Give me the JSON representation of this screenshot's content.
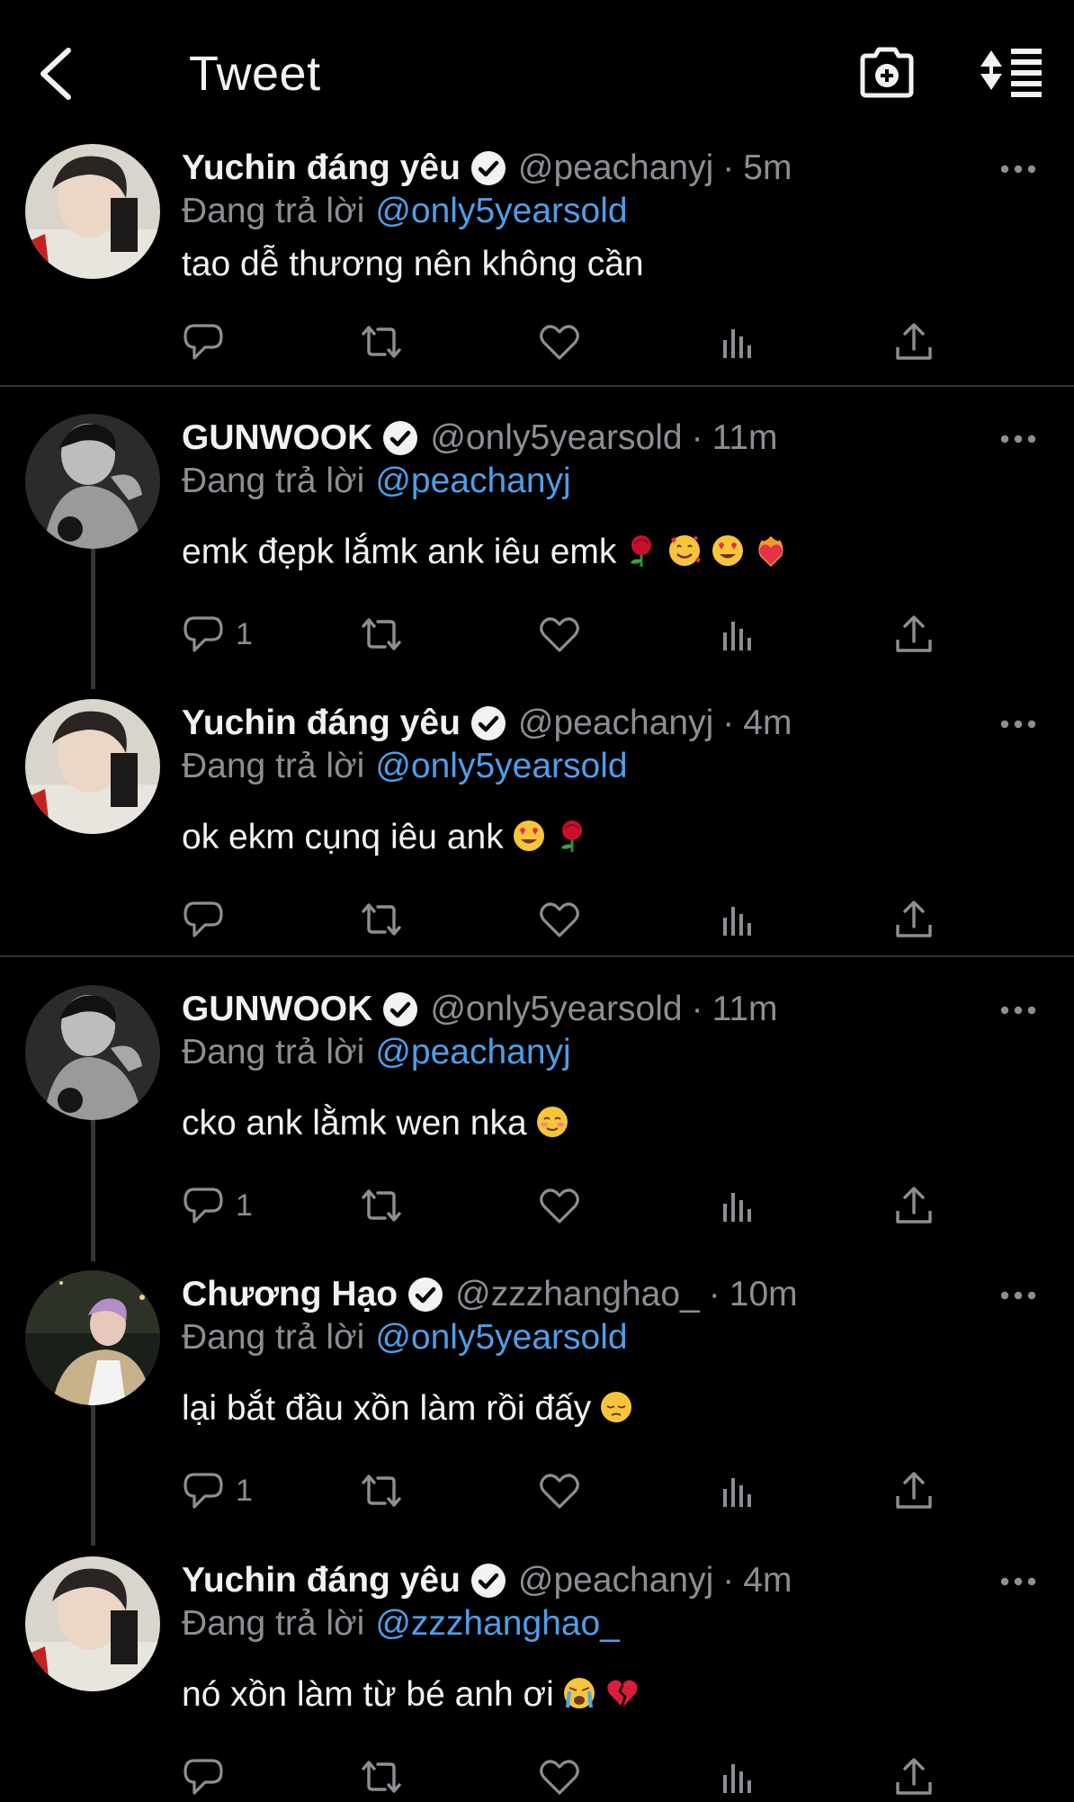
{
  "header": {
    "title": "Tweet"
  },
  "tweets": [
    {
      "name": "Yuchin đáng yêu",
      "handle": "@peachanyj",
      "time": "5m",
      "reply_label": "Đang trả lời",
      "reply_to": "@only5yearsold",
      "text": "tao dễ thương nên không cần",
      "reply_count": "",
      "avatar": "avatar-yuchin",
      "emojis": []
    },
    {
      "name": "GUNWOOK",
      "handle": "@only5yearsold",
      "time": "11m",
      "reply_label": "Đang trả lời",
      "reply_to": "@peachanyj",
      "text": "emk đẹpk lắmk ank iêu emk",
      "reply_count": "1",
      "avatar": "avatar-gunwook",
      "emojis": [
        "rose-emoji",
        "smiling-hearts-emoji",
        "heart-eyes-emoji",
        "heart-on-fire-emoji"
      ]
    },
    {
      "name": "Yuchin đáng yêu",
      "handle": "@peachanyj",
      "time": "4m",
      "reply_label": "Đang trả lời",
      "reply_to": "@only5yearsold",
      "text": "ok ekm cụnq iêu ank",
      "reply_count": "",
      "avatar": "avatar-yuchin",
      "emojis": [
        "heart-eyes-emoji",
        "rose-emoji"
      ]
    },
    {
      "name": "GUNWOOK",
      "handle": "@only5yearsold",
      "time": "11m",
      "reply_label": "Đang trả lời",
      "reply_to": "@peachanyj",
      "text": "cko ank lằmk wen nka",
      "reply_count": "1",
      "avatar": "avatar-gunwook",
      "emojis": [
        "smiling-blush-emoji"
      ]
    },
    {
      "name": "Chương Hạo",
      "handle": "@zzzhanghao_",
      "time": "10m",
      "reply_label": "Đang trả lời",
      "reply_to": "@only5yearsold",
      "text": "lại bắt đầu xồn làm rồi đấy",
      "reply_count": "1",
      "avatar": "avatar-zhanghao",
      "emojis": [
        "pensive-emoji"
      ]
    },
    {
      "name": "Yuchin đáng yêu",
      "handle": "@peachanyj",
      "time": "4m",
      "reply_label": "Đang trả lời",
      "reply_to": "@zzzhanghao_",
      "text": "nó xồn làm từ bé anh ơi",
      "reply_count": "",
      "avatar": "avatar-yuchin",
      "emojis": [
        "crying-emoji",
        "broken-heart-emoji"
      ]
    }
  ]
}
